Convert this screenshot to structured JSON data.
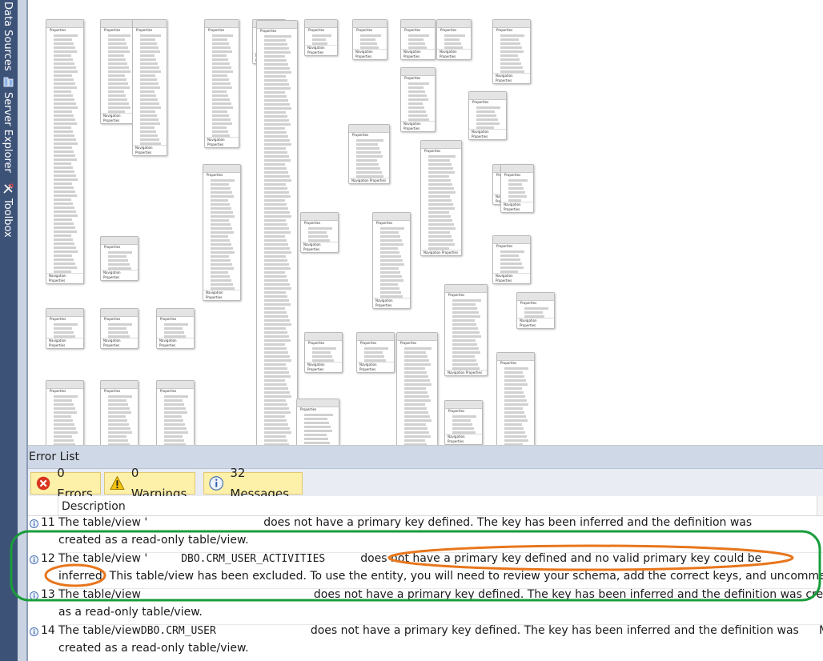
{
  "dock": {
    "tabs": [
      {
        "label": "Data Sources",
        "icon": "data-sources-icon"
      },
      {
        "label": "Server Explorer",
        "icon": "server-explorer-icon"
      },
      {
        "label": "Toolbox",
        "icon": "toolbox-icon"
      }
    ]
  },
  "designer": {
    "entity_section_label": "Properties",
    "entity_nav_label": "Navigation Properties"
  },
  "error_list": {
    "title": "Error List",
    "filters": {
      "errors": "0 Errors",
      "warnings": "0 Warnings",
      "messages": "32 Messages"
    },
    "column_description": "Description",
    "rows": [
      {
        "num": "11",
        "line1_a": "The table/view '",
        "line1_b": "does not have a primary key defined. The key has been inferred and the definition was",
        "line2": "created as a read-only table/view.",
        "file": ""
      },
      {
        "num": "12",
        "line1_a": "The table/view '",
        "entity": "DBO.CRM_USER_ACTIVITIES",
        "line1_b": "does not have a primary key defined and no valid primary key could be",
        "line2": "inferred. This table/view has been excluded. To use the entity, you will need to review your schema, add the correct keys, and uncomment it.",
        "file": ""
      },
      {
        "num": "13",
        "line1_a": "The table/view",
        "line1_b": "does not have a primary key defined. The key has been inferred and the definition was created",
        "line2": "as a read-only table/view.",
        "file": ""
      },
      {
        "num": "14",
        "line1_a": "The table/view",
        "entity": "DBO.CRM_USER",
        "line1_b": "does not have a primary key defined. The key has been inferred and the definition was",
        "line2": "created as a read-only table/view.",
        "file": "M"
      }
    ]
  },
  "colors": {
    "dock": "#3d5277",
    "filter_active": "#fdf0a9",
    "highlight_green": "#1a9c3c",
    "highlight_orange": "#e8761c"
  }
}
